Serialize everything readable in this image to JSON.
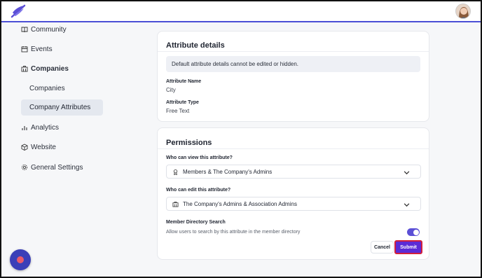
{
  "sidebar": {
    "items": [
      {
        "label": "Community",
        "icon": "book-icon"
      },
      {
        "label": "Events",
        "icon": "calendar-icon"
      },
      {
        "label": "Companies",
        "icon": "building-icon"
      },
      {
        "label": "Companies"
      },
      {
        "label": "Company Attributes"
      },
      {
        "label": "Analytics",
        "icon": "bar-chart-icon"
      },
      {
        "label": "Website",
        "icon": "cube-icon"
      },
      {
        "label": "General Settings",
        "icon": "gear-icon"
      }
    ]
  },
  "attribute_details": {
    "title": "Attribute details",
    "notice": "Default attribute details cannot be edited or hidden.",
    "name_label": "Attribute Name",
    "name_value": "City",
    "type_label": "Attribute Type",
    "type_value": "Free Text"
  },
  "permissions": {
    "title": "Permissions",
    "view_label": "Who can view this attribute?",
    "view_value": "Members & The Company's Admins",
    "edit_label": "Who can edit this attribute?",
    "edit_value": "The Company's Admins & Association Admins",
    "search_label": "Member Directory Search",
    "search_help": "Allow users to search by this attribute in the member directory",
    "search_enabled": true
  },
  "actions": {
    "cancel": "Cancel",
    "submit": "Submit"
  },
  "colors": {
    "accent": "#5b2bd6",
    "highlight": "#d21f3c"
  }
}
